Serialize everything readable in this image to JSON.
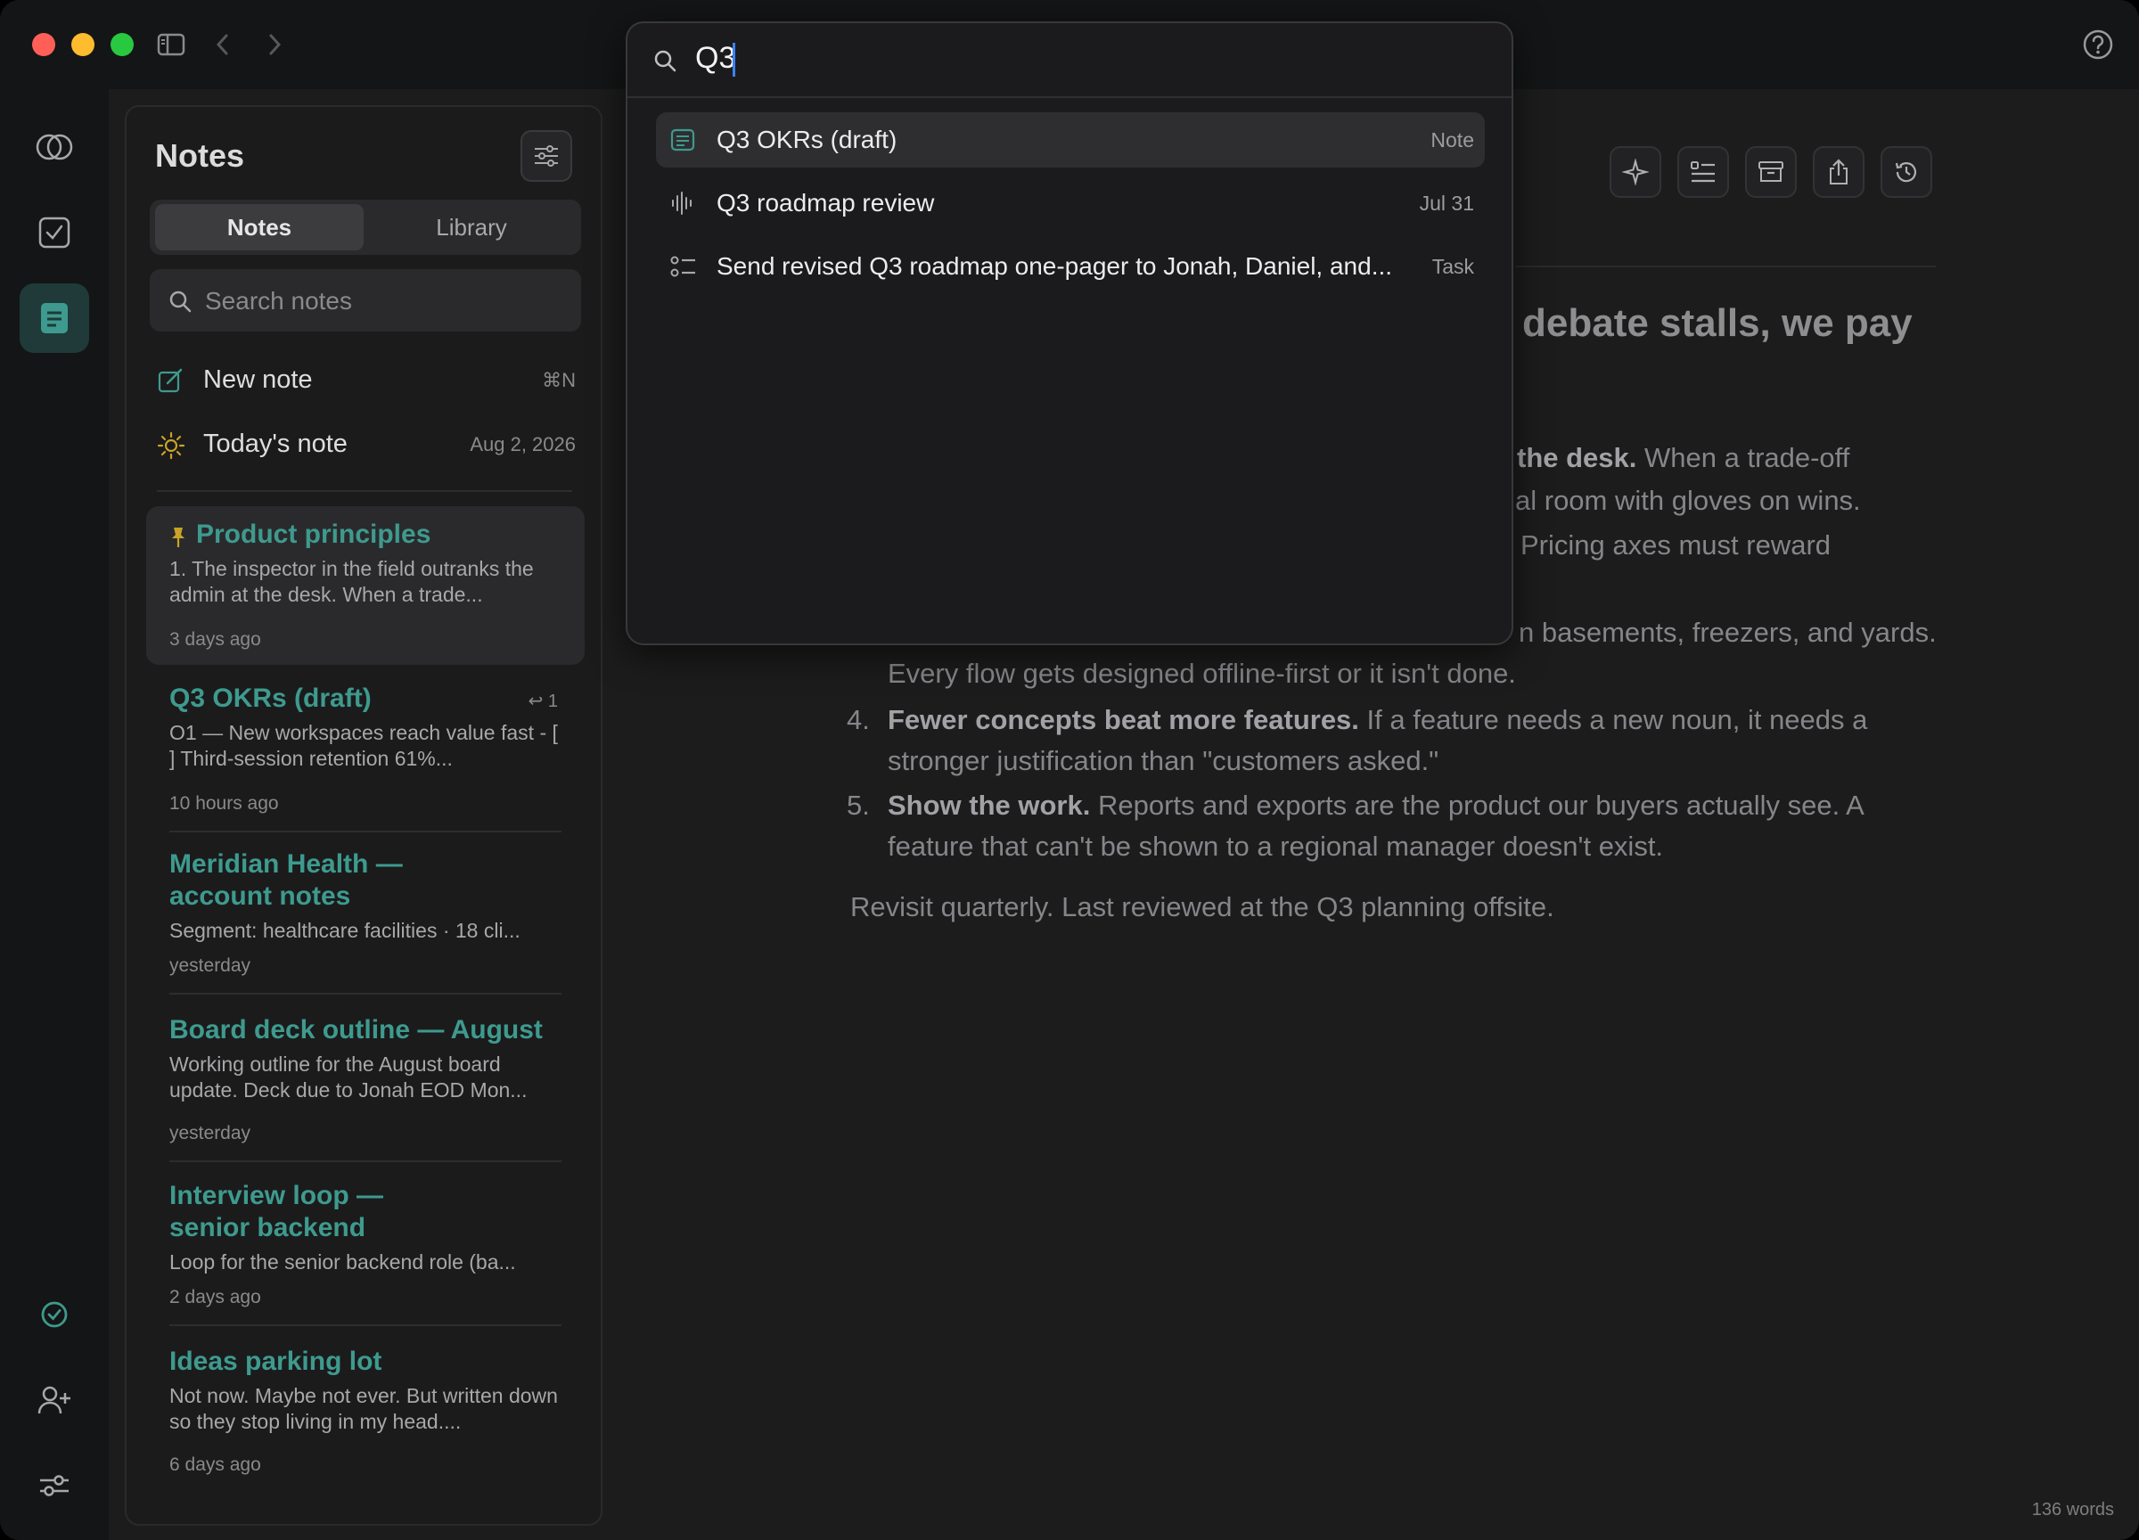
{
  "palette": {
    "query": "Q3",
    "results": [
      {
        "label": "Q3 OKRs (draft)",
        "kind": "Note",
        "icon": "note-icon"
      },
      {
        "label": "Q3 roadmap review",
        "kind": "Jul 31",
        "icon": "waveform-icon"
      },
      {
        "label": "Send revised Q3 roadmap one-pager to Jonah, Daniel, and...",
        "kind": "Task",
        "icon": "task-list-icon"
      }
    ]
  },
  "notes_panel": {
    "title": "Notes",
    "tabs": [
      "Notes",
      "Library"
    ],
    "search_placeholder": "Search notes",
    "new_note": {
      "label": "New note",
      "shortcut": "⌘N"
    },
    "todays_note": {
      "label": "Today's note",
      "date": "Aug 2, 2026"
    },
    "notes": [
      {
        "title": "Product principles",
        "snippet": "1. The inspector in the field outranks the admin at the desk. When a trade...",
        "time": "3 days ago",
        "pinned": true
      },
      {
        "title": "Q3 OKRs (draft)",
        "snippet": "O1 — New workspaces reach value fast - [ ] Third-session retention 61%...",
        "time": "10 hours ago",
        "backlinks": "↩ 1"
      },
      {
        "title": "Meridian Health — account notes",
        "snippet": "Segment: healthcare facilities · 18 cli...",
        "time": "yesterday"
      },
      {
        "title": "Board deck outline — August",
        "snippet": "Working outline for the August board update. Deck due to Jonah EOD Mon...",
        "time": "yesterday"
      },
      {
        "title": "Interview loop — senior backend",
        "snippet": "Loop for the senior backend role (ba...",
        "time": "2 days ago"
      },
      {
        "title": "Ideas parking lot",
        "snippet": "Not now. Maybe not ever. But written down so they stop living in my head....",
        "time": "6 days ago"
      }
    ]
  },
  "editor": {
    "heading_fragment": "debate stalls, we pay",
    "p1_bold": "the desk.",
    "p1_rest": " When a trade-off",
    "p1_line2": "al room with gloves on wins.",
    "p1_line3": "Pricing axes must reward",
    "p3_tail": "n basements, freezers, and yards.",
    "p3_line2": "Every flow gets designed offline-first or it isn't done.",
    "item4_num": "4.",
    "item4_bold": "Fewer concepts beat more features.",
    "item4_rest": " If a feature needs a new noun, it needs a",
    "item4_line2": "stronger justification than \"customers asked.\"",
    "item5_num": "5.",
    "item5_bold": "Show the work.",
    "item5_rest": " Reports and exports are the product our buyers actually see. A",
    "item5_line2": "feature that can't be shown to a regional manager doesn't exist.",
    "footer": "Revisit quarterly. Last reviewed at the Q3 planning offsite.",
    "word_count": "136 words"
  },
  "colors": {
    "accent": "#3e9a8e",
    "background": "#1c1c1d"
  }
}
